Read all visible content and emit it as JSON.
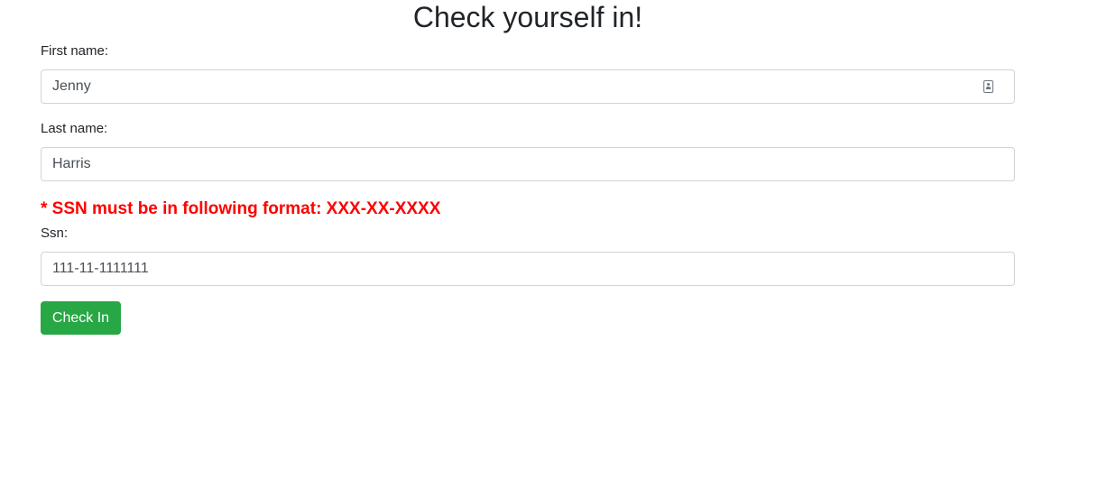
{
  "title": "Check yourself in!",
  "form": {
    "first_name": {
      "label": "First name:",
      "value": "Jenny"
    },
    "last_name": {
      "label": "Last name:",
      "value": "Harris"
    },
    "ssn_error": "* SSN must be in following format: XXX-XX-XXXX",
    "ssn": {
      "label": "Ssn:",
      "value": "111-11-1111111"
    },
    "submit_label": "Check In"
  },
  "colors": {
    "error": "#ff0000",
    "button": "#28a745",
    "field_border": "#ced4da"
  },
  "icons": {
    "first_name_field": "contact-card-icon"
  }
}
